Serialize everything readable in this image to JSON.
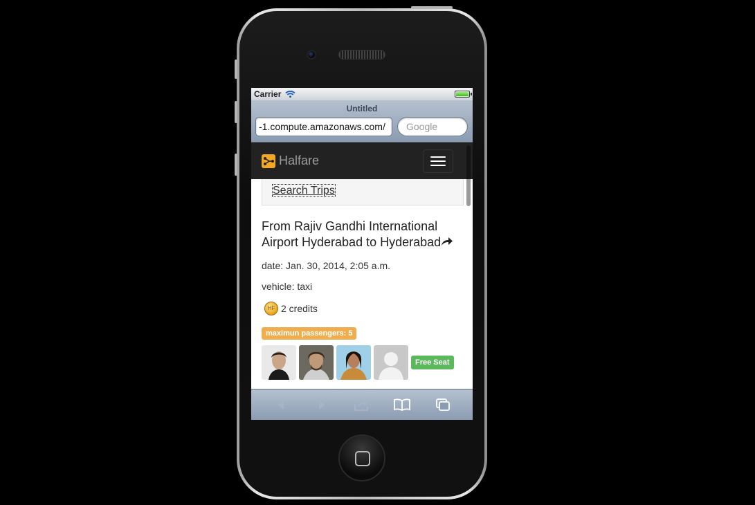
{
  "status_bar": {
    "carrier": "Carrier"
  },
  "browser": {
    "page_title": "Untitled",
    "url": "-1.compute.amazonaws.com/",
    "search_placeholder": "Google"
  },
  "site": {
    "brand": "Halfare",
    "menu": {
      "items": [
        "Search Trips"
      ]
    }
  },
  "trip": {
    "title": "From Rajiv Gandhi International Airport Hyderabad to Hyderabad",
    "share_icon": "share-icon",
    "date": "date: Jan. 30, 2014, 2:05 a.m.",
    "vehicle": "vehicle: taxi",
    "coin_label": "HF",
    "credits": "2 credits",
    "max_passengers": "maximun passengers: 5",
    "free_seat": "Free Seat"
  },
  "toolbar": {
    "icons": [
      "back-icon",
      "forward-icon",
      "share-icon",
      "bookmarks-icon",
      "tabs-icon"
    ]
  },
  "colors": {
    "navbar": "#222222",
    "brand_icon": "#f5a623",
    "warning": "#f0ad4e",
    "success": "#5cb85c"
  }
}
